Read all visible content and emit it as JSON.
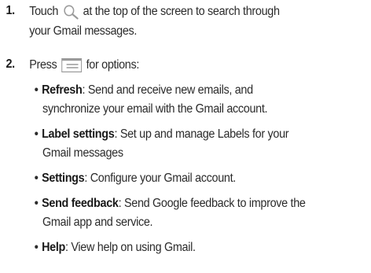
{
  "steps": [
    {
      "number": "1.",
      "line1_before": "Touch",
      "line1_icon": "search-icon",
      "line1_after": "at the top of the screen to search through",
      "line2": "your Gmail messages."
    },
    {
      "number": "2.",
      "before": "Press",
      "icon": "menu-icon",
      "after": "for options:"
    }
  ],
  "options": [
    {
      "term": "Refresh",
      "desc_line1": ": Send and receive new emails, and",
      "desc_line2": "synchronize your email with the Gmail account."
    },
    {
      "term": "Label settings",
      "desc_line1": ": Set up and manage Labels for your",
      "desc_line2": "Gmail messages"
    },
    {
      "term": "Settings",
      "desc_line1": ": Configure your Gmail account."
    },
    {
      "term": "Send feedback",
      "desc_line1": ": Send Google feedback to improve the",
      "desc_line2": "Gmail app and service."
    },
    {
      "term": "Help",
      "desc_line1": ": View help on using Gmail."
    }
  ],
  "bullet_char": "•",
  "colors": {
    "text": "#2b2b2b",
    "icon": "#9a9a9a"
  }
}
